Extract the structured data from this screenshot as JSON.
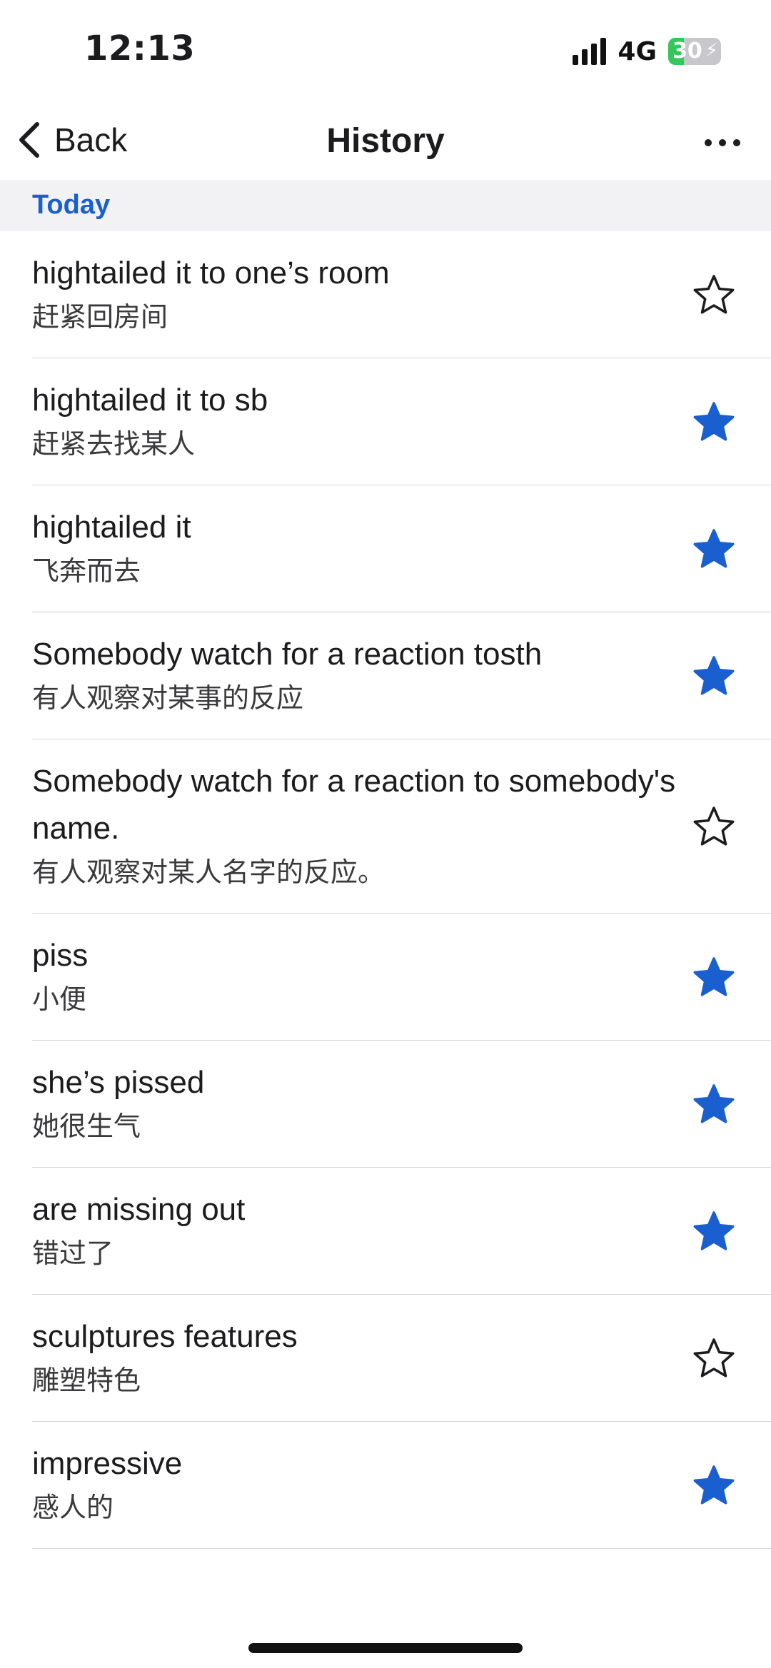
{
  "status_bar": {
    "time": "12:13",
    "network": "4G",
    "battery_percent": "30",
    "battery_level": 0.3,
    "charging": true
  },
  "nav": {
    "back_label": "Back",
    "title": "History"
  },
  "section": {
    "label": "Today"
  },
  "colors": {
    "accent": "#1a5fd0",
    "star_filled": "#1a5fd0",
    "star_outline": "#1c1c1e"
  },
  "items": [
    {
      "term": "hightailed it to one’s room",
      "translation": "赶紧回房间",
      "starred": false
    },
    {
      "term": "hightailed it to sb",
      "translation": "赶紧去找某人",
      "starred": true
    },
    {
      "term": "hightailed it",
      "translation": "飞奔而去",
      "starred": true
    },
    {
      "term": "Somebody watch for a reaction tosth",
      "translation": "有人观察对某事的反应",
      "starred": true
    },
    {
      "term": "Somebody watch for a reaction to somebody's name.",
      "translation": "有人观察对某人名字的反应。",
      "starred": false
    },
    {
      "term": "piss",
      "translation": "小便",
      "starred": true
    },
    {
      "term": "she’s pissed",
      "translation": "她很生气",
      "starred": true
    },
    {
      "term": "are missing out",
      "translation": "错过了",
      "starred": true
    },
    {
      "term": "sculptures features",
      "translation": "雕塑特色",
      "starred": false
    },
    {
      "term": "impressive",
      "translation": "感人的",
      "starred": true
    }
  ]
}
